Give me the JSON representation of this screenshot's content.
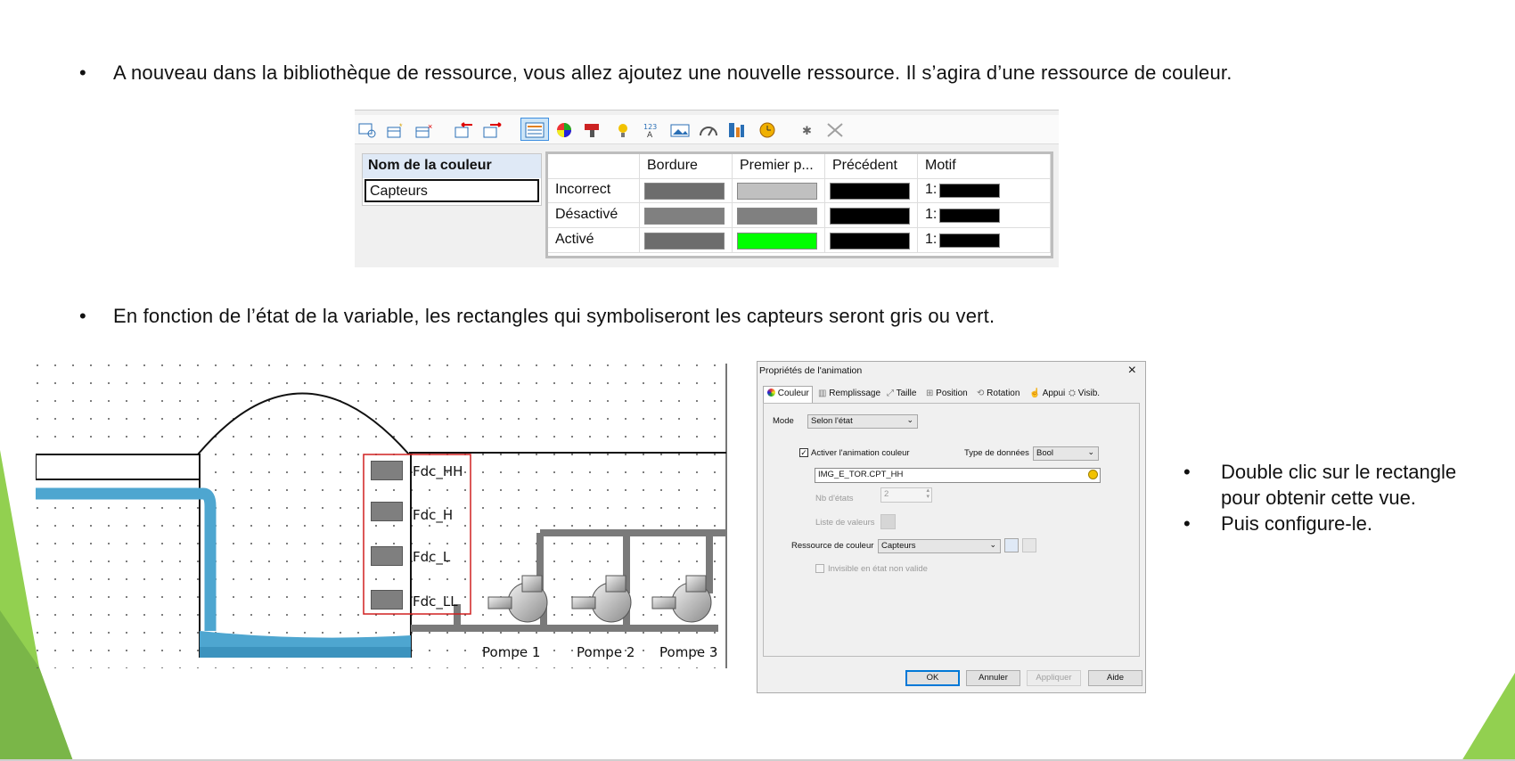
{
  "slide": {
    "bullet1": "A nouveau dans la bibliothèque de ressource, vous allez ajoutez une nouvelle ressource. Il s’agira d’une ressource de couleur.",
    "bullet2": "En fonction de l’état de la variable, les rectangles qui symboliseront les capteurs seront gris ou vert.",
    "bullet_char": "•",
    "side_bullets": [
      "Double clic sur le rectangle pour obtenir cette vue.",
      "Puis configure-le."
    ],
    "accent_color": "#92d050"
  },
  "color_resource": {
    "toolbar_icons": [
      "new-view-icon",
      "add-icon",
      "delete-icon",
      "move-left-icon",
      "move-right-icon",
      "color-table-icon",
      "color-wheel-icon",
      "paint-icon",
      "bulb-icon",
      "number-text-icon",
      "image-icon",
      "gauge-icon",
      "ruler-icon",
      "clock-icon",
      "sparkle-icon",
      "close-x-icon"
    ],
    "name_header": "Nom de la couleur",
    "name_value": "Capteurs",
    "columns": [
      "",
      "Bordure",
      "Premier p...",
      "Précédent",
      "Motif"
    ],
    "rows": [
      {
        "label": "Incorrect",
        "bordure": "#6d6d6d",
        "premier": "#c0c0c0",
        "precedent": "#000000",
        "motif_index": "1:",
        "motif": "#000000"
      },
      {
        "label": "Désactivé",
        "bordure": "#808080",
        "premier": "#808080",
        "precedent": "#000000",
        "motif_index": "1:",
        "motif": "#000000"
      },
      {
        "label": "Activé",
        "bordure": "#6d6d6d",
        "premier": "#00ff00",
        "precedent": "#000000",
        "motif_index": "1:",
        "motif": "#000000"
      }
    ]
  },
  "diagram": {
    "sensors": [
      "Fdc_HH",
      "Fdc_H",
      "Fdc_L",
      "Fdc_LL"
    ],
    "pumps": [
      "Pompe 1",
      "Pompe 2",
      "Pompe 3"
    ],
    "water_color": "#4ea6d0",
    "selection_color": "#d02020"
  },
  "dialog": {
    "title": "Propriétés de l'animation",
    "close": "×",
    "tabs": [
      "Couleur",
      "Remplissage",
      "Taille",
      "Position",
      "Rotation",
      "Appui",
      "Visib."
    ],
    "mode_label": "Mode",
    "mode_value": "Selon l'état",
    "activate_label": "Activer l'animation couleur",
    "activate_checked": true,
    "data_type_label": "Type de données",
    "data_type_value": "Bool",
    "variable_value": "IMG_E_TOR.CPT_HH",
    "nb_states_label": "Nb d'états",
    "nb_states_value": "2",
    "values_list_label": "Liste de valeurs",
    "color_resource_label": "Ressource de couleur",
    "color_resource_value": "Capteurs",
    "invisible_label": "Invisible en état non valide",
    "buttons": {
      "ok": "OK",
      "cancel": "Annuler",
      "apply": "Appliquer",
      "help": "Aide"
    }
  }
}
